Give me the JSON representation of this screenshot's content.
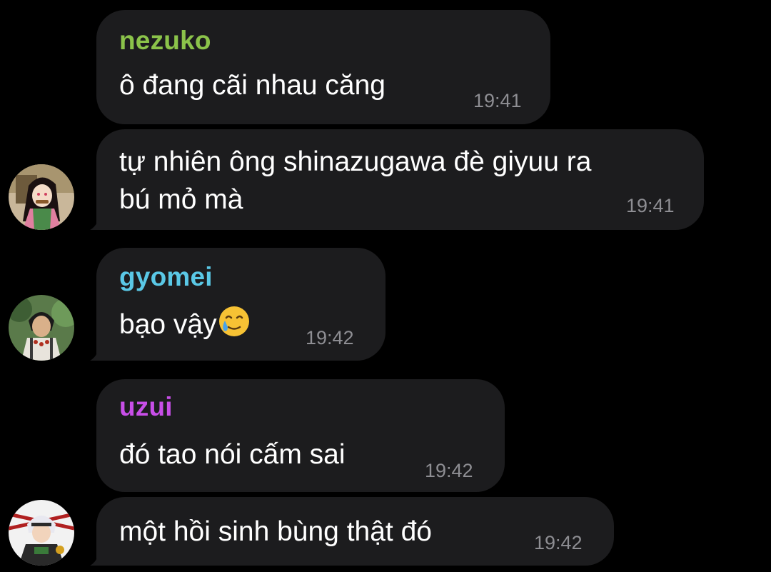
{
  "messages": [
    {
      "sender": "nezuko",
      "sender_color": "#8bc34a",
      "text": "ô đang cãi nhau căng",
      "time": "19:41"
    },
    {
      "text_line1": "tự nhiên ông shinazugawa đè giyuu ra",
      "text_line2": "bú mỏ mà",
      "time": "19:41"
    },
    {
      "sender": "gyomei",
      "sender_color": "#5ac8e6",
      "text": "bạo vậy",
      "emoji": "🥲",
      "time": "19:42"
    },
    {
      "sender": "uzui",
      "sender_color": "#c84ee8",
      "text": "đó tao nói cấm sai",
      "time": "19:42"
    },
    {
      "text": "một hồi sinh bùng thật đó",
      "time": "19:42"
    }
  ],
  "avatars": {
    "nezuko": "nezuko-avatar",
    "gyomei": "gyomei-avatar",
    "uzui": "uzui-avatar"
  }
}
